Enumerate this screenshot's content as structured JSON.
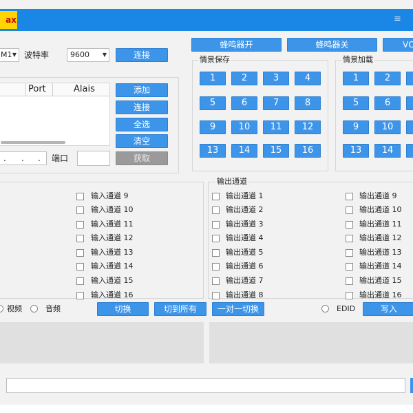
{
  "titlebar": {
    "logo_text": "ax",
    "button_glyph": "≡"
  },
  "serial": {
    "port_value": "M1",
    "baud_label": "波特率",
    "baud_value": "9600",
    "connect_label": "连接"
  },
  "device_list": {
    "columns": [
      "Port",
      "Alais"
    ],
    "buttons": [
      "添加",
      "连接",
      "全选",
      "清空"
    ],
    "ip_dots": [
      ".",
      ".",
      "."
    ],
    "port_label": "端口",
    "fetch_label": "获取"
  },
  "buzzer": {
    "on_label": "蜂鸣器开",
    "off_label": "蜂鸣器关",
    "extra_label": "VC"
  },
  "scene_save": {
    "title": "情景保存",
    "numbers": [
      "1",
      "2",
      "3",
      "4",
      "5",
      "6",
      "7",
      "8",
      "9",
      "10",
      "11",
      "12",
      "13",
      "14",
      "15",
      "16"
    ]
  },
  "scene_load": {
    "title": "情景加载",
    "numbers": [
      "1",
      "2",
      "5",
      "6",
      "9",
      "10",
      "13",
      "14"
    ]
  },
  "input_channels": {
    "items": [
      "输入通道 9",
      "输入通道 10",
      "输入通道 11",
      "输入通道 12",
      "输入通道 13",
      "输入通道 14",
      "输入通道 15",
      "输入通道 16"
    ]
  },
  "output_channels": {
    "title": "输出通道",
    "left_items": [
      "输出通道 1",
      "输出通道 2",
      "输出通道 3",
      "输出通道 4",
      "输出通道 5",
      "输出通道 6",
      "输出通道 7",
      "输出通道 8"
    ],
    "right_items": [
      "输出通道 9",
      "输出通道 10",
      "输出通道 11",
      "输出通道 12",
      "输出通道 13",
      "输出通道 14",
      "输出通道 15",
      "输出通道 16"
    ]
  },
  "controls": {
    "video_label": "视频",
    "audio_label": "音频",
    "switch_label": "切换",
    "switch_all_label": "切到所有",
    "one_to_one_label": "一对一切换",
    "edid_label": "EDID",
    "write_label": "写入"
  },
  "colors": {
    "accent": "#3d95ea",
    "titlebar": "#1a86e6",
    "logo": "#ffd400",
    "disabled": "#9a9a9a"
  }
}
